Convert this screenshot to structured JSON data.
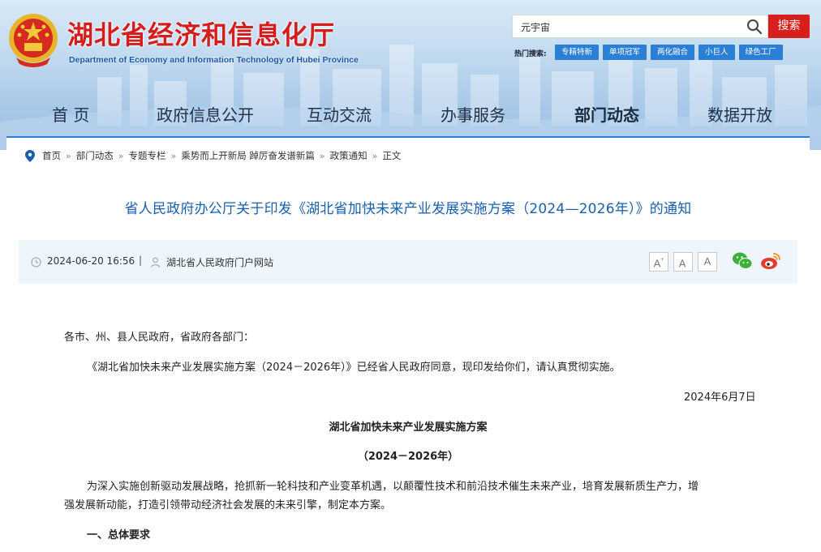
{
  "site": {
    "title": "湖北省经济和信息化厅",
    "subtitle": "Department of Economy and Information Technology of Hubei Province"
  },
  "search": {
    "value": "元宇宙",
    "button_label": "搜索"
  },
  "hot_search": {
    "label": "热门搜索:",
    "tags": [
      "专精特新",
      "单项冠军",
      "两化融合",
      "小巨人",
      "绿色工厂"
    ]
  },
  "nav": {
    "items": [
      "首 页",
      "政府信息公开",
      "互动交流",
      "办事服务",
      "部门动态",
      "数据开放"
    ],
    "active": "部门动态"
  },
  "breadcrumb": [
    "首页",
    "部门动态",
    "专题专栏",
    "乘势而上开新局 踔厉奋发谱新篇",
    "政策通知",
    "正文"
  ],
  "article": {
    "title": "省人民政府办公厅关于印发《湖北省加快未来产业发展实施方案（2024—2026年）》的通知",
    "date": "2024-06-20 16:56",
    "divider": "|",
    "source": "湖北省人民政府门户网站",
    "font_sizes": [
      "A+",
      "A",
      "A"
    ],
    "share": [
      "wechat-icon",
      "weibo-icon"
    ],
    "salutation": "各市、州、县人民政府，省政府各部门：",
    "intro": "《湖北省加快未来产业发展实施方案（2024－2026年）》已经省人民政府同意，现印发给你们，请认真贯彻实施。",
    "sign_date": "2024年6月7日",
    "plan_title": "湖北省加快未来产业发展实施方案",
    "plan_subtitle": "（2024－2026年）",
    "para1_line1": "为深入实施创新驱动发展战略，抢抓新一轮科技和产业变革机遇，以颠覆性技术和前沿技术催生未来产业，培育发展新质生产力，增",
    "para1_line2": "强发展新动能，打造引领带动经济社会发展的未来引擎，制定本方案。",
    "section1": "一、总体要求"
  },
  "colors": {
    "brand_red": "#d41d1d",
    "title_blue": "#1a5fae",
    "tag_blue": "#2b7fd4",
    "meta_bg": "#eef5fb"
  }
}
